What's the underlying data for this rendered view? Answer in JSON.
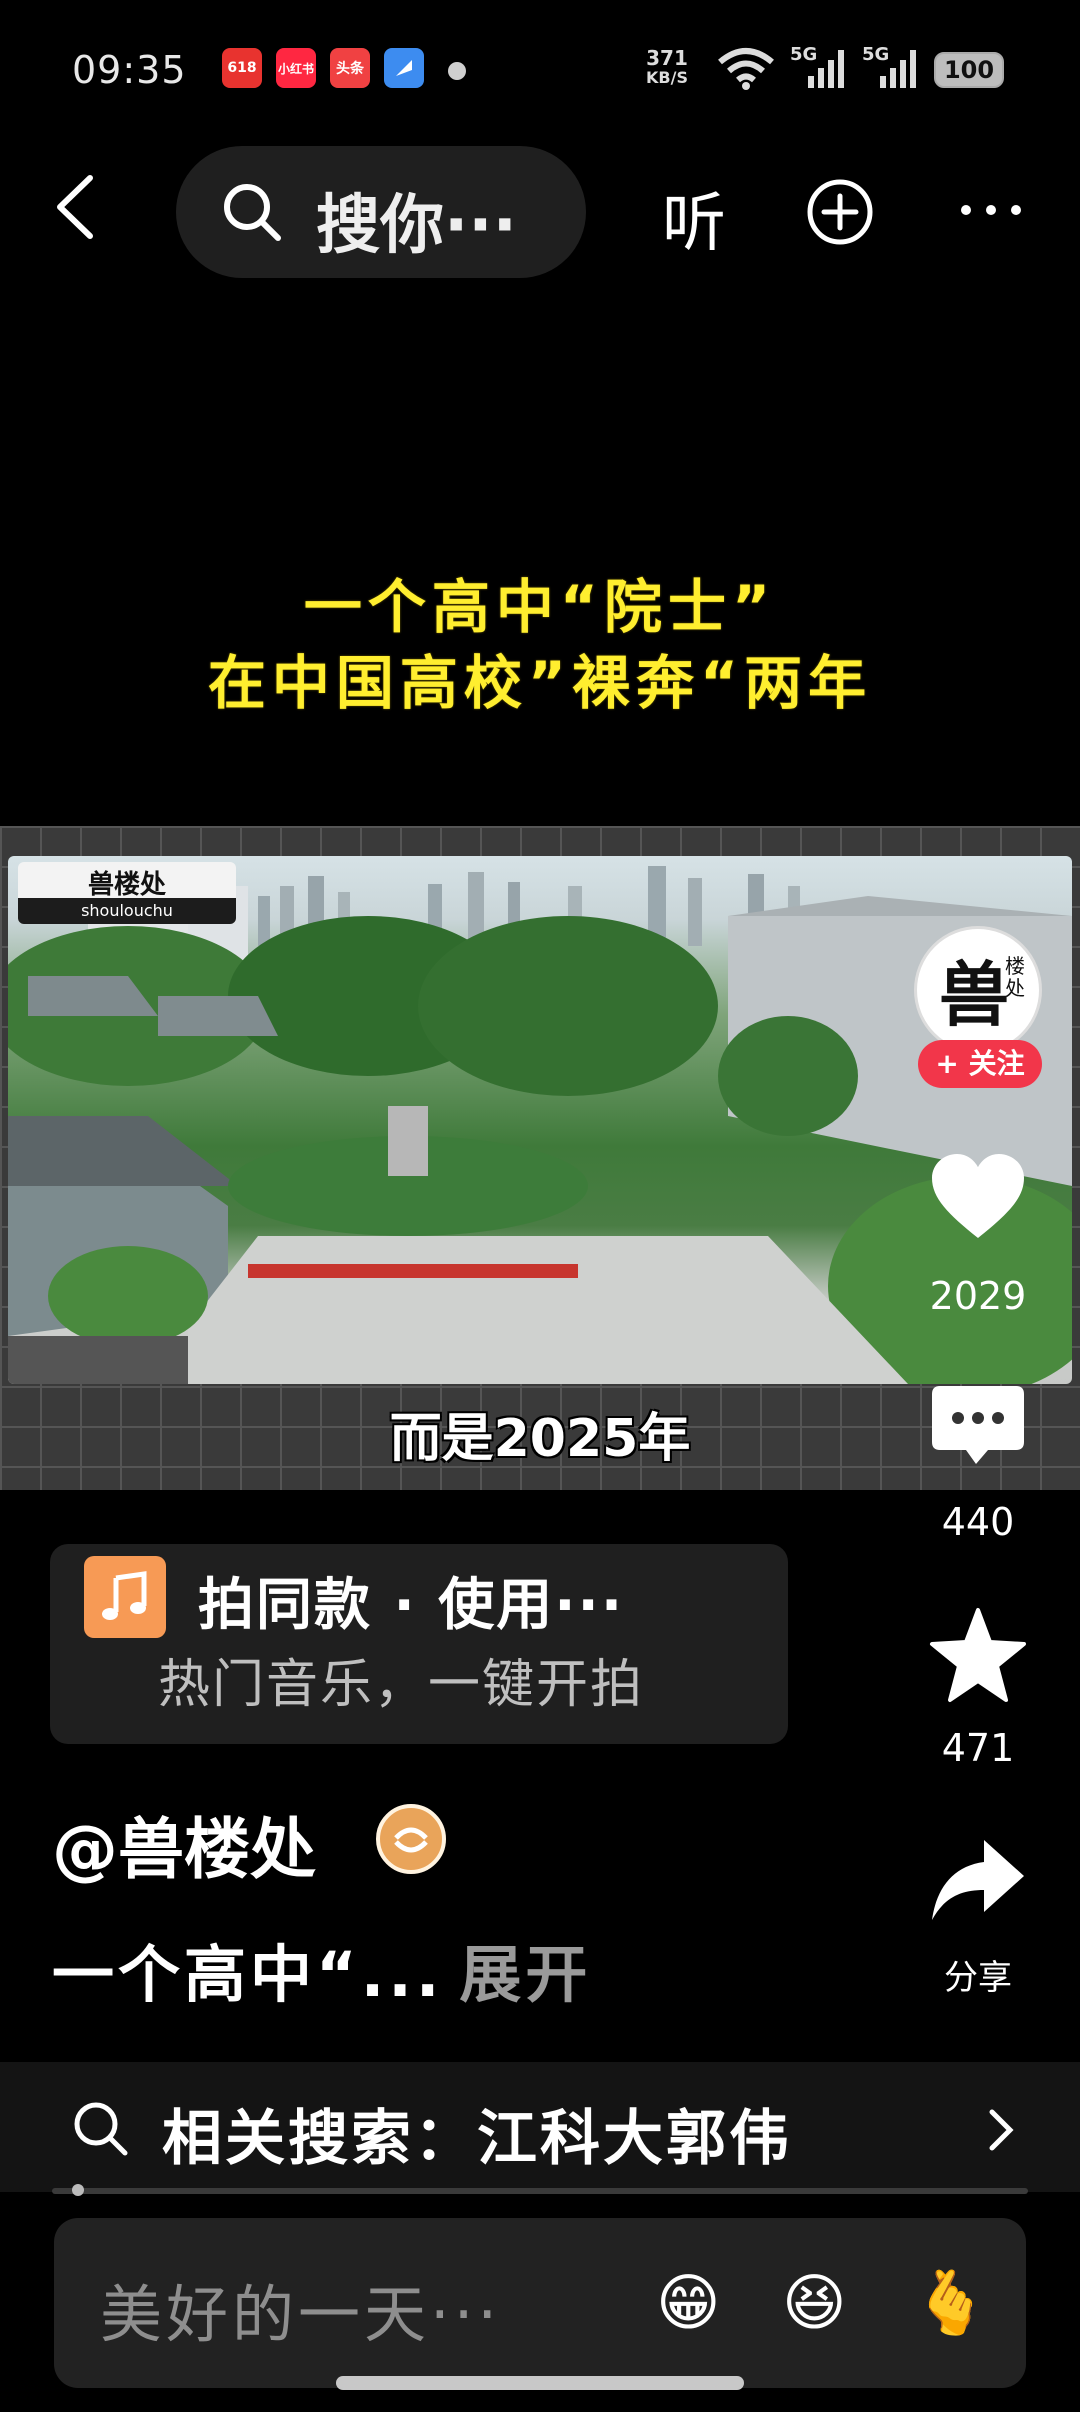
{
  "status": {
    "time": "09:35",
    "apps": [
      {
        "label": "618",
        "color": "#e8332f"
      },
      {
        "label": "小红书",
        "color": "#ff2741"
      },
      {
        "label": "头条",
        "color": "#f04142"
      },
      {
        "label": "",
        "color": "#3d8cf0"
      }
    ],
    "net_speed_value": "371",
    "net_speed_unit": "KB/S",
    "signal1": "5G",
    "signal2": "5G",
    "battery": "100"
  },
  "topbar": {
    "search_text": "搜你···",
    "listen_label": "听"
  },
  "overlay": {
    "line1": "一个高中“院士”",
    "line2": "在中国高校”裸奔“两年"
  },
  "video": {
    "logo_cn": "兽楼处",
    "logo_en": "shoulouchu",
    "subtitle": "而是2025年"
  },
  "rail": {
    "avatar_big": "兽",
    "avatar_small": "楼处",
    "follow_label": "+ 关注",
    "likes": "2029",
    "comments": "440",
    "favorites": "471",
    "share_label": "分享"
  },
  "music": {
    "title": "拍同款 · 使用···",
    "subtitle": "热门音乐，一键开拍"
  },
  "post": {
    "author": "@兽楼处",
    "description": "一个高中“...",
    "expand_label": "展开"
  },
  "related": {
    "text": "相关搜索：江科大郭伟"
  },
  "playback": {
    "progress_fraction": 0.02
  },
  "comment_bar": {
    "placeholder": "美好的一天···",
    "emojis": [
      "😁",
      "😆",
      "🫰"
    ]
  }
}
